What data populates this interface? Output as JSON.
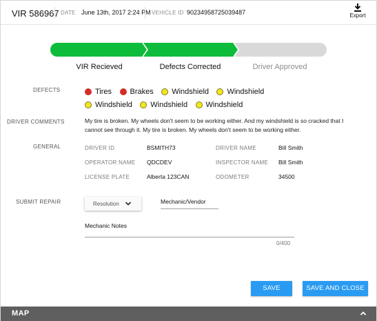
{
  "header": {
    "vir_number": "VIR 586967",
    "date_label": "DATE",
    "date_value": "June 13th, 2017  2:24 PM",
    "vehicle_id_label": "VEHICLE ID",
    "vehicle_id_value": "90234958725039487",
    "export_label": "Export",
    "export_icon": "download-icon"
  },
  "progress": {
    "steps": [
      {
        "label": "VIR Recieved",
        "status": "complete",
        "color": "#0dbc3a"
      },
      {
        "label": "Defects Corrected",
        "status": "complete",
        "color": "#0dbc3a"
      },
      {
        "label": "Driver Approved",
        "status": "pending",
        "color": "#d9d9d9"
      }
    ]
  },
  "defects": {
    "label": "DEFECTS",
    "items": [
      {
        "name": "Tires",
        "severity": "red"
      },
      {
        "name": "Brakes",
        "severity": "red"
      },
      {
        "name": "Windshield",
        "severity": "yellow"
      },
      {
        "name": "Windshield",
        "severity": "yellow"
      },
      {
        "name": "Windshield",
        "severity": "yellow"
      },
      {
        "name": "Windshield",
        "severity": "yellow"
      },
      {
        "name": "Windshield",
        "severity": "yellow"
      }
    ]
  },
  "driver_comments": {
    "label": "DRIVER COMMENTS",
    "text": "My tire is broken. My wheels don't seem to be working either. And my windshield is so cracked that I cannot see through it. My tire is broken. My wheels don't seem to be working either."
  },
  "general": {
    "label": "GENERAL",
    "fields": {
      "driver_id_label": "DRIVER ID",
      "driver_id_value": "BSMITH73",
      "driver_name_label": "DRIVER NAME",
      "driver_name_value": "Bill Smith",
      "operator_name_label": "OPERATOR NAME",
      "operator_name_value": "QDCDEV",
      "inspector_name_label": "INSPECTOR NAME",
      "inspector_name_value": "Bill Smith",
      "license_plate_label": "LICENSE PLATE",
      "license_plate_value": "Alberta 123CAN",
      "odometer_label": "ODOMETER",
      "odometer_value": "34500"
    }
  },
  "submit_repair": {
    "label": "SUBMIT REPAIR",
    "resolution_value": "Resolution",
    "mechanic_vendor_value": "Mechanic/Vendor",
    "notes_label": "Mechanic Notes",
    "notes_count": "0/400"
  },
  "buttons": {
    "save_label": "SAVE",
    "save_close_label": "SAVE AND CLOSE",
    "accent_color": "#2a9bf2"
  },
  "map": {
    "label": "MAP",
    "caret_icon": "chevron-up-icon"
  },
  "colors": {
    "defect_red": "#d32d27",
    "defect_yellow": "#f6e51a",
    "map_bar": "#5f5f5f"
  }
}
